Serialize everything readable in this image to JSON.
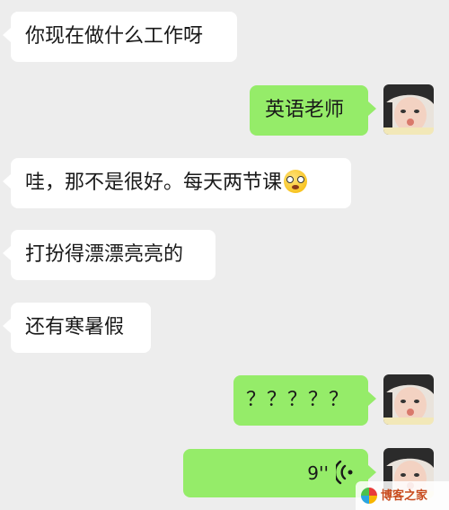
{
  "messages": [
    {
      "side": "in",
      "text": "你现在做什么工作呀"
    },
    {
      "side": "out",
      "text": "英语老师"
    },
    {
      "side": "in",
      "text": "哇，那不是很好。每天两节课",
      "emoji": "smiling-face-with-glasses-emoji"
    },
    {
      "side": "in",
      "text": "打扮得漂漂亮亮的"
    },
    {
      "side": "in",
      "text": "还有寒暑假"
    },
    {
      "side": "out",
      "text": "？？？？？"
    },
    {
      "side": "out",
      "type": "voice",
      "duration": "9''"
    }
  ],
  "watermark": {
    "text": "博客之家"
  },
  "colors": {
    "background": "#ededed",
    "incoming": "#ffffff",
    "outgoing": "#95ec69"
  }
}
